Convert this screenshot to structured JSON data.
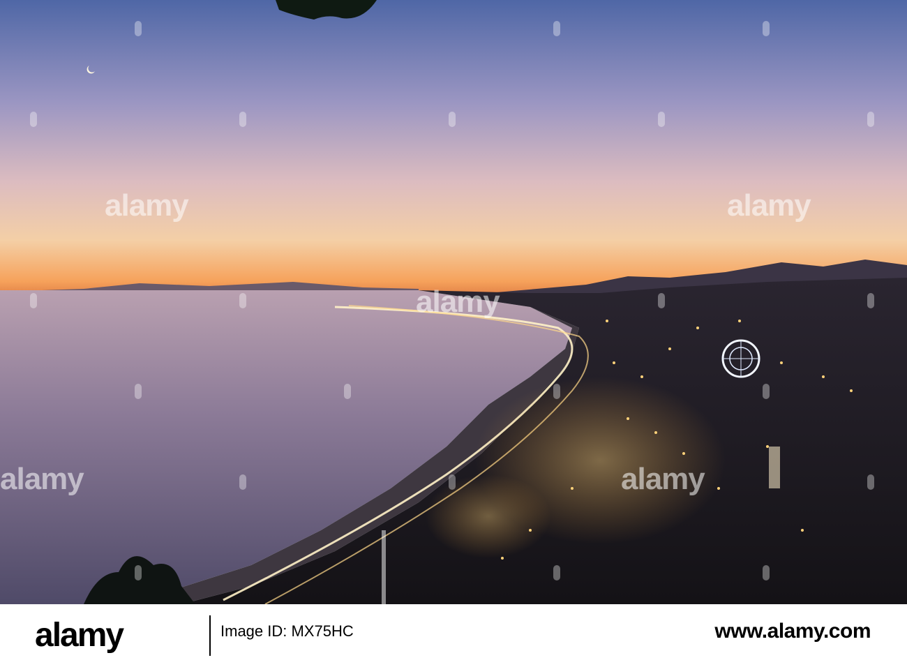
{
  "photo": {
    "subject": "Nice coastline at dusk",
    "sky_colors": [
      "#5a6ea8",
      "#9a94c0",
      "#d8b7b8",
      "#f3c7a3",
      "#f39a54"
    ],
    "sea_color": "#7c6c8a",
    "city_color": "#1e1b22"
  },
  "watermarks": [
    {
      "text": "alamy"
    },
    {
      "text": "alamy"
    },
    {
      "text": "alamy"
    },
    {
      "text": "alamy"
    },
    {
      "text": "alamy"
    }
  ],
  "footer": {
    "logo_text": "alamy",
    "image_id": "Image ID: MX75HC",
    "url": "www.alamy.com"
  }
}
